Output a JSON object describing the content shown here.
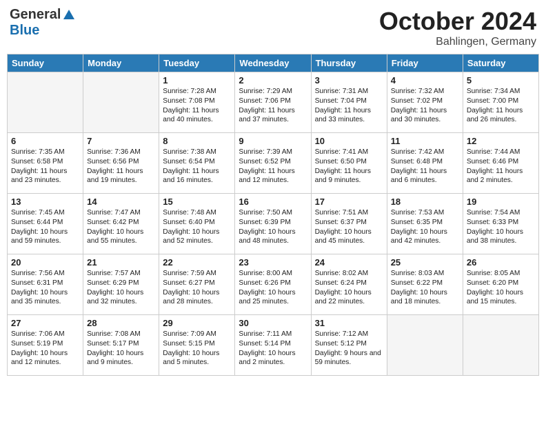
{
  "header": {
    "logo_general": "General",
    "logo_blue": "Blue",
    "month": "October 2024",
    "location": "Bahlingen, Germany"
  },
  "weekdays": [
    "Sunday",
    "Monday",
    "Tuesday",
    "Wednesday",
    "Thursday",
    "Friday",
    "Saturday"
  ],
  "weeks": [
    [
      {
        "day": "",
        "text": ""
      },
      {
        "day": "",
        "text": ""
      },
      {
        "day": "1",
        "text": "Sunrise: 7:28 AM\nSunset: 7:08 PM\nDaylight: 11 hours and 40 minutes."
      },
      {
        "day": "2",
        "text": "Sunrise: 7:29 AM\nSunset: 7:06 PM\nDaylight: 11 hours and 37 minutes."
      },
      {
        "day": "3",
        "text": "Sunrise: 7:31 AM\nSunset: 7:04 PM\nDaylight: 11 hours and 33 minutes."
      },
      {
        "day": "4",
        "text": "Sunrise: 7:32 AM\nSunset: 7:02 PM\nDaylight: 11 hours and 30 minutes."
      },
      {
        "day": "5",
        "text": "Sunrise: 7:34 AM\nSunset: 7:00 PM\nDaylight: 11 hours and 26 minutes."
      }
    ],
    [
      {
        "day": "6",
        "text": "Sunrise: 7:35 AM\nSunset: 6:58 PM\nDaylight: 11 hours and 23 minutes."
      },
      {
        "day": "7",
        "text": "Sunrise: 7:36 AM\nSunset: 6:56 PM\nDaylight: 11 hours and 19 minutes."
      },
      {
        "day": "8",
        "text": "Sunrise: 7:38 AM\nSunset: 6:54 PM\nDaylight: 11 hours and 16 minutes."
      },
      {
        "day": "9",
        "text": "Sunrise: 7:39 AM\nSunset: 6:52 PM\nDaylight: 11 hours and 12 minutes."
      },
      {
        "day": "10",
        "text": "Sunrise: 7:41 AM\nSunset: 6:50 PM\nDaylight: 11 hours and 9 minutes."
      },
      {
        "day": "11",
        "text": "Sunrise: 7:42 AM\nSunset: 6:48 PM\nDaylight: 11 hours and 6 minutes."
      },
      {
        "day": "12",
        "text": "Sunrise: 7:44 AM\nSunset: 6:46 PM\nDaylight: 11 hours and 2 minutes."
      }
    ],
    [
      {
        "day": "13",
        "text": "Sunrise: 7:45 AM\nSunset: 6:44 PM\nDaylight: 10 hours and 59 minutes."
      },
      {
        "day": "14",
        "text": "Sunrise: 7:47 AM\nSunset: 6:42 PM\nDaylight: 10 hours and 55 minutes."
      },
      {
        "day": "15",
        "text": "Sunrise: 7:48 AM\nSunset: 6:40 PM\nDaylight: 10 hours and 52 minutes."
      },
      {
        "day": "16",
        "text": "Sunrise: 7:50 AM\nSunset: 6:39 PM\nDaylight: 10 hours and 48 minutes."
      },
      {
        "day": "17",
        "text": "Sunrise: 7:51 AM\nSunset: 6:37 PM\nDaylight: 10 hours and 45 minutes."
      },
      {
        "day": "18",
        "text": "Sunrise: 7:53 AM\nSunset: 6:35 PM\nDaylight: 10 hours and 42 minutes."
      },
      {
        "day": "19",
        "text": "Sunrise: 7:54 AM\nSunset: 6:33 PM\nDaylight: 10 hours and 38 minutes."
      }
    ],
    [
      {
        "day": "20",
        "text": "Sunrise: 7:56 AM\nSunset: 6:31 PM\nDaylight: 10 hours and 35 minutes."
      },
      {
        "day": "21",
        "text": "Sunrise: 7:57 AM\nSunset: 6:29 PM\nDaylight: 10 hours and 32 minutes."
      },
      {
        "day": "22",
        "text": "Sunrise: 7:59 AM\nSunset: 6:27 PM\nDaylight: 10 hours and 28 minutes."
      },
      {
        "day": "23",
        "text": "Sunrise: 8:00 AM\nSunset: 6:26 PM\nDaylight: 10 hours and 25 minutes."
      },
      {
        "day": "24",
        "text": "Sunrise: 8:02 AM\nSunset: 6:24 PM\nDaylight: 10 hours and 22 minutes."
      },
      {
        "day": "25",
        "text": "Sunrise: 8:03 AM\nSunset: 6:22 PM\nDaylight: 10 hours and 18 minutes."
      },
      {
        "day": "26",
        "text": "Sunrise: 8:05 AM\nSunset: 6:20 PM\nDaylight: 10 hours and 15 minutes."
      }
    ],
    [
      {
        "day": "27",
        "text": "Sunrise: 7:06 AM\nSunset: 5:19 PM\nDaylight: 10 hours and 12 minutes."
      },
      {
        "day": "28",
        "text": "Sunrise: 7:08 AM\nSunset: 5:17 PM\nDaylight: 10 hours and 9 minutes."
      },
      {
        "day": "29",
        "text": "Sunrise: 7:09 AM\nSunset: 5:15 PM\nDaylight: 10 hours and 5 minutes."
      },
      {
        "day": "30",
        "text": "Sunrise: 7:11 AM\nSunset: 5:14 PM\nDaylight: 10 hours and 2 minutes."
      },
      {
        "day": "31",
        "text": "Sunrise: 7:12 AM\nSunset: 5:12 PM\nDaylight: 9 hours and 59 minutes."
      },
      {
        "day": "",
        "text": ""
      },
      {
        "day": "",
        "text": ""
      }
    ]
  ]
}
